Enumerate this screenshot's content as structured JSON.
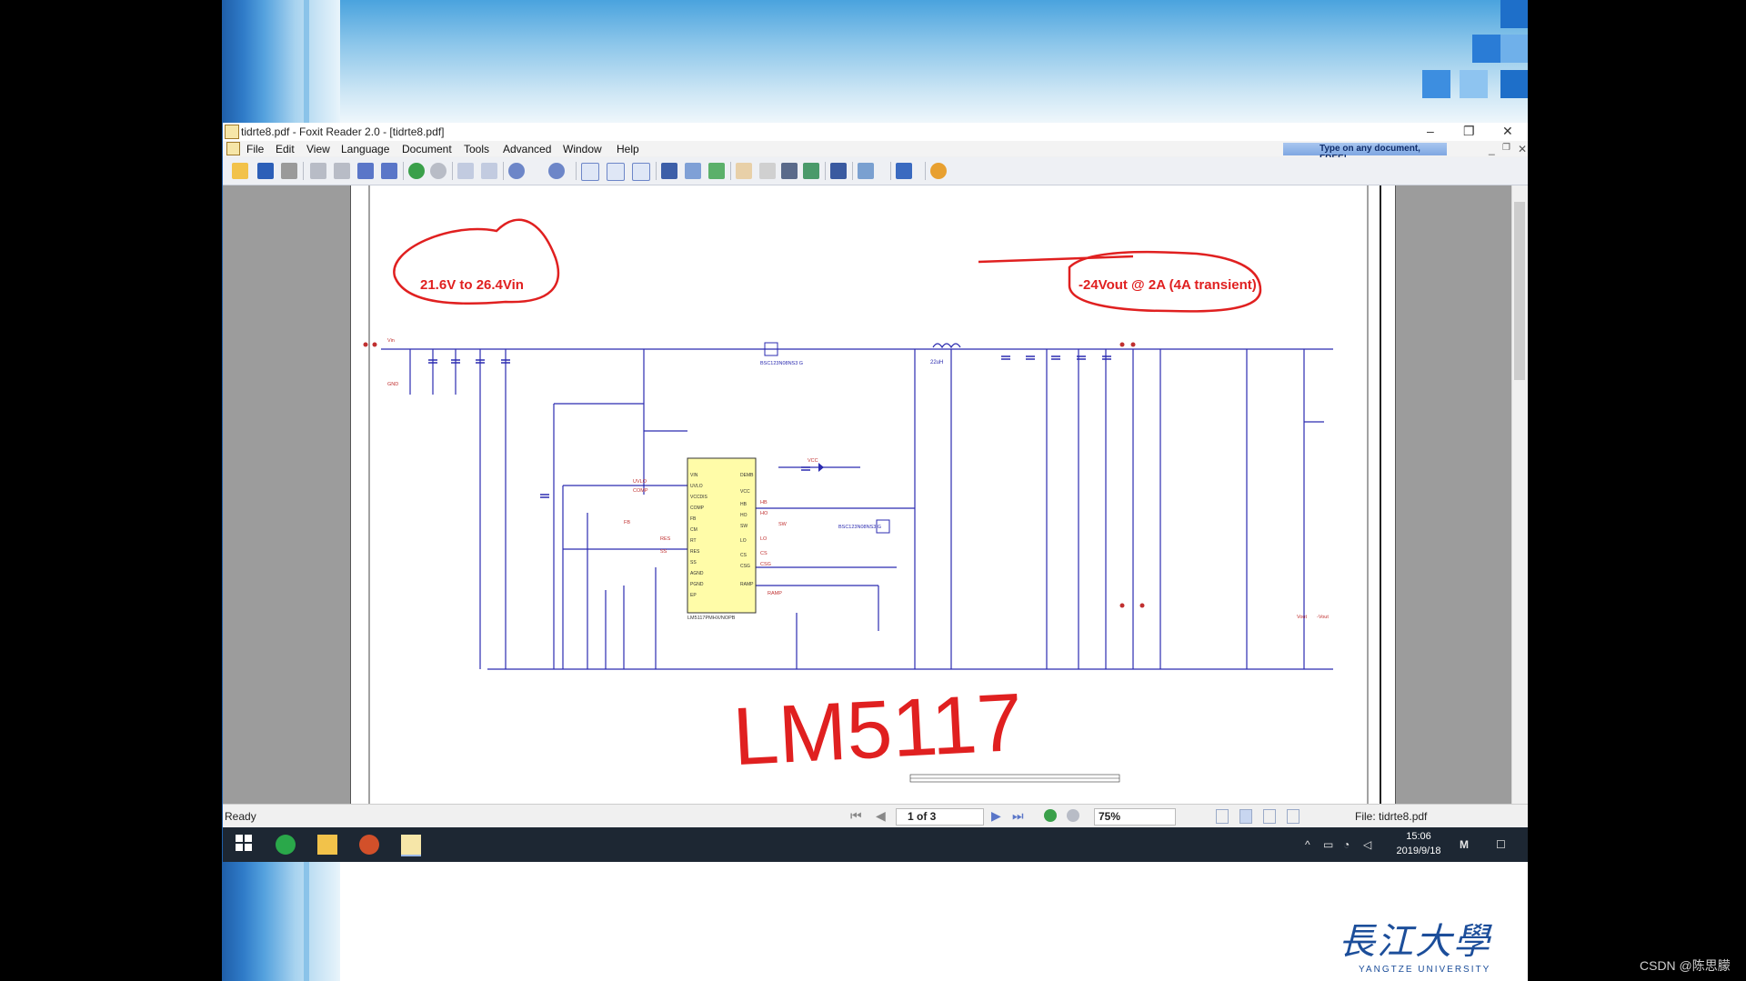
{
  "window": {
    "title": "tidrte8.pdf - Foxit Reader 2.0 - [tidrte8.pdf]",
    "controls": [
      "–",
      "❐",
      "✕"
    ]
  },
  "menu": {
    "items": [
      "File",
      "Edit",
      "View",
      "Language",
      "Document",
      "Tools",
      "Advanced",
      "Window",
      "Help"
    ],
    "promo": "Type on any document, FREE!"
  },
  "schematic": {
    "annotation_left": "21.6V to 26.4Vin",
    "annotation_right": "-24Vout @ 2A (4A transient)",
    "handwritten": "LM5117",
    "ic_label": "LM5117PMHX/NOPB",
    "left_pins": [
      "VIN",
      "UVLO",
      "VCCDIS",
      "COMP",
      "FB",
      "CM",
      "RT",
      "RES",
      "SS",
      "AGND",
      "PGND",
      "EP"
    ],
    "right_pins": [
      "DEMB",
      "VCC",
      "HB",
      "HO",
      "SW",
      "LO",
      "CS",
      "CSG",
      "RAMP"
    ],
    "inductor": "22uH",
    "fet_high": "BSC123N08NS3 G",
    "fet_low": "BSC123N08NS3 G",
    "net_labels": [
      "UVLO",
      "COMP",
      "FB",
      "RES",
      "SS",
      "RAMP",
      "HB",
      "HO",
      "SW",
      "LO",
      "CS",
      "CSG",
      "VCC",
      "Vin",
      "GND",
      "Vout",
      "-Vout"
    ]
  },
  "status": {
    "ready": "Ready",
    "page": "1 of 3",
    "zoom": "75%",
    "file": "File: tidrte8.pdf"
  },
  "taskbar": {
    "time": "15:06",
    "date": "2019/9/18"
  },
  "footer": "CSDN @陈思朦",
  "logo": {
    "chinese": "長江大學",
    "english": "YANGTZE UNIVERSITY"
  },
  "colors": {
    "annotation": "#e02020",
    "wire": "#2b2bb0",
    "ic_fill": "#fffca8"
  }
}
